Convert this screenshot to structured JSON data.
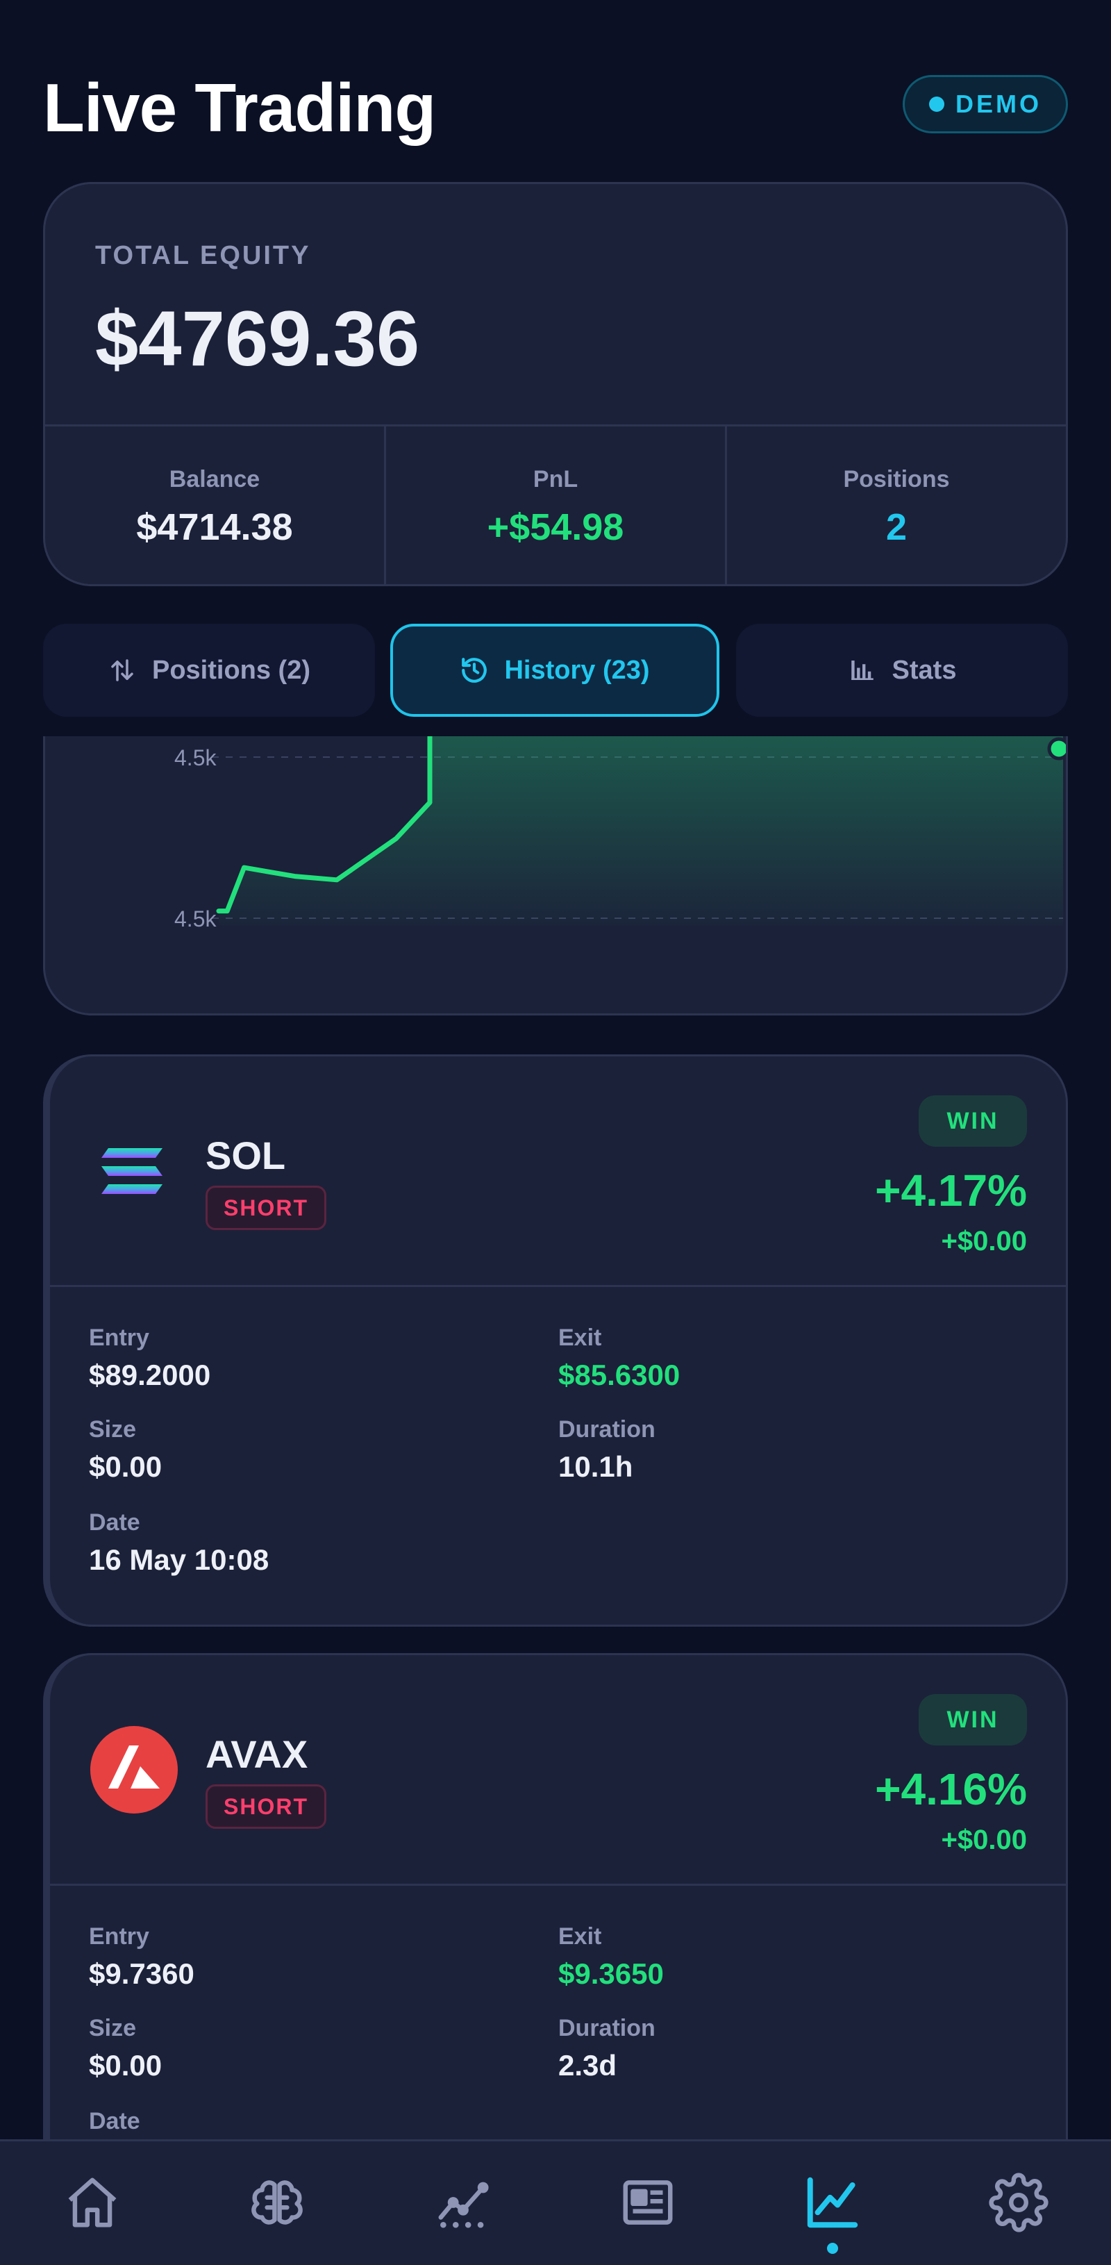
{
  "header": {
    "title": "Live Trading",
    "mode_badge": "DEMO"
  },
  "equity": {
    "label": "TOTAL EQUITY",
    "value": "$4769.36",
    "stats": [
      {
        "label": "Balance",
        "value": "$4714.38"
      },
      {
        "label": "PnL",
        "value": "+$54.98"
      },
      {
        "label": "Positions",
        "value": "2"
      }
    ]
  },
  "tabs": [
    {
      "label": "Positions (2)",
      "icon": "swap-vertical-icon"
    },
    {
      "label": "History (23)",
      "icon": "history-icon",
      "active": true
    },
    {
      "label": "Stats",
      "icon": "bar-chart-icon"
    }
  ],
  "chart_data": {
    "type": "area",
    "tick_labels": [
      "4.5k",
      "4.5k"
    ],
    "series": [
      {
        "values": [
          4500,
          4500,
          4560,
          4548,
          4543,
          4600,
          4650,
          4769,
          4769,
          4769,
          4769
        ]
      }
    ],
    "ylim": [
      4490,
      4780
    ],
    "grid": true
  },
  "trades": [
    {
      "symbol": "SOL",
      "side": "SHORT",
      "result": "WIN",
      "pct": "+4.17%",
      "pnl": "+$0.00",
      "logo": "solana-logo-icon",
      "details": [
        {
          "label": "Entry",
          "value": "$89.2000"
        },
        {
          "label": "Exit",
          "value": "$85.6300"
        },
        {
          "label": "Size",
          "value": "$0.00"
        },
        {
          "label": "Duration",
          "value": "10.1h"
        },
        {
          "label": "Date",
          "value": "16 May 10:08"
        }
      ]
    },
    {
      "symbol": "AVAX",
      "side": "SHORT",
      "result": "WIN",
      "pct": "+4.16%",
      "pnl": "+$0.00",
      "logo": "avalanche-logo-icon",
      "details": [
        {
          "label": "Entry",
          "value": "$9.7360"
        },
        {
          "label": "Exit",
          "value": "$9.3650"
        },
        {
          "label": "Size",
          "value": "$0.00"
        },
        {
          "label": "Duration",
          "value": "2.3d"
        },
        {
          "label": "Date",
          "value": ""
        }
      ]
    }
  ],
  "nav": [
    {
      "icon": "home-icon"
    },
    {
      "icon": "brain-icon"
    },
    {
      "icon": "analytics-icon"
    },
    {
      "icon": "news-icon"
    },
    {
      "icon": "trading-chart-icon",
      "active": true
    },
    {
      "icon": "settings-gear-icon"
    }
  ],
  "colors": {
    "background": "#0b1024",
    "card": "#1b2139",
    "accent": "#22c7ee",
    "positive": "#22e07c",
    "short": "#ff3f6c"
  }
}
